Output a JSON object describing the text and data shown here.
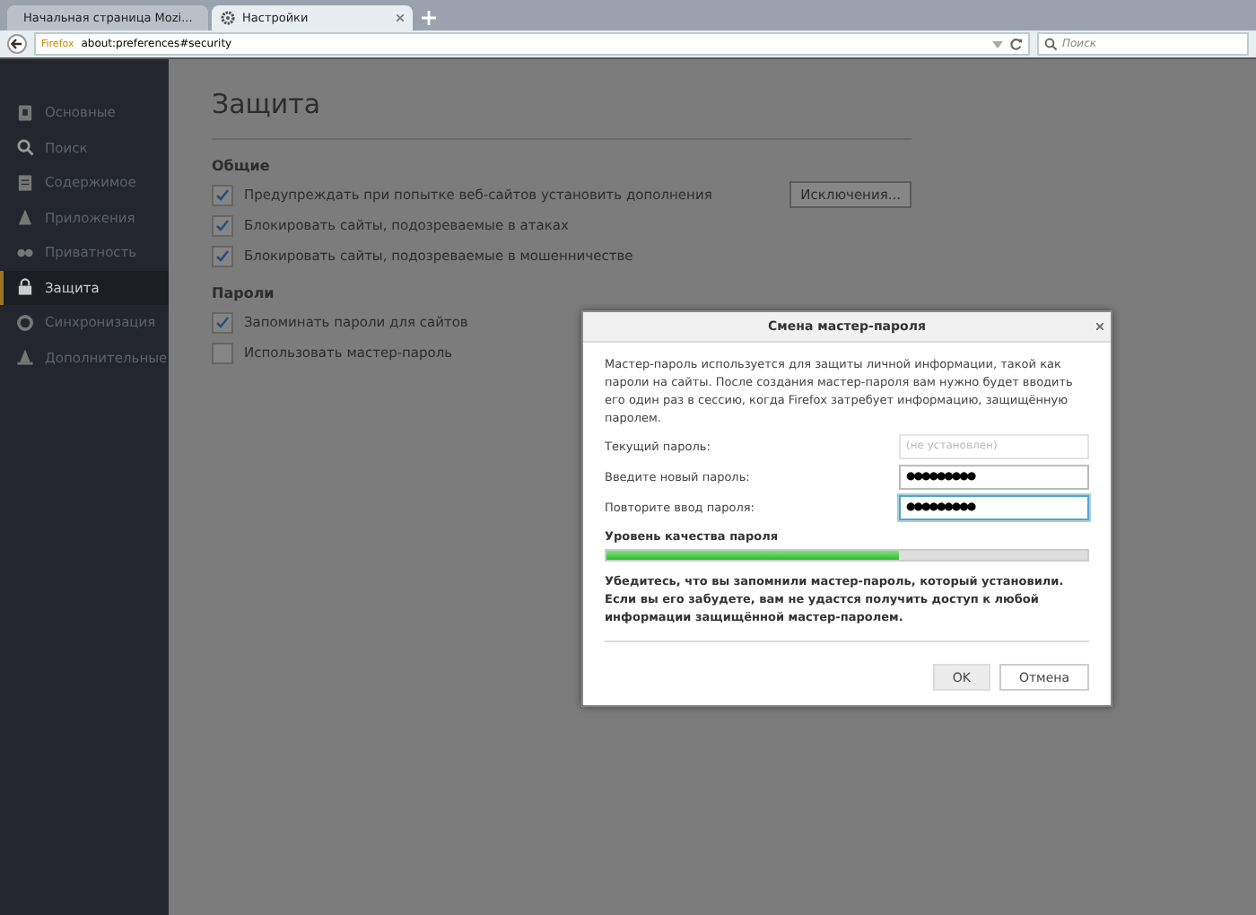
{
  "tabs": [
    {
      "label": "Начальная страница Mozi...",
      "selected": false,
      "kind": "firefox"
    },
    {
      "label": "Настройки",
      "selected": true,
      "kind": "settings"
    }
  ],
  "toolbar": {
    "identity": "Firefox",
    "url": "about:preferences#security",
    "search_placeholder": "Поиск"
  },
  "sidebar": {
    "items": [
      {
        "label": "Основные",
        "kind": "general",
        "selected": false
      },
      {
        "label": "Поиск",
        "kind": "search",
        "selected": false
      },
      {
        "label": "Содержимое",
        "kind": "content",
        "selected": false
      },
      {
        "label": "Приложения",
        "kind": "apps",
        "selected": false
      },
      {
        "label": "Приватность",
        "kind": "privacy",
        "selected": false
      },
      {
        "label": "Защита",
        "kind": "security",
        "selected": true
      },
      {
        "label": "Синхронизация",
        "kind": "sync",
        "selected": false
      },
      {
        "label": "Дополнительные",
        "kind": "advanced",
        "selected": false
      }
    ]
  },
  "page": {
    "title": "Защита",
    "sections": [
      {
        "heading": "Общие",
        "options": [
          {
            "label": "Предупреждать при попытке веб-сайтов установить дополнения",
            "checked": true,
            "button": "Исключения..."
          },
          {
            "label": "Блокировать сайты, подозреваемые в атаках",
            "checked": true
          },
          {
            "label": "Блокировать сайты, подозреваемые в мошенничестве",
            "checked": true
          }
        ]
      },
      {
        "heading": "Пароли",
        "options": [
          {
            "label": "Запоминать пароли для сайтов",
            "checked": true
          },
          {
            "label": "Использовать мастер-пароль",
            "checked": false
          }
        ]
      }
    ]
  },
  "dialog": {
    "title": "Смена мастер-пароля",
    "intro": "Мастер-пароль используется для защиты личной информации, такой как пароли на сайты. После создания мастер-пароля вам нужно будет вводить его один раз в сессию, когда Firefox затребует информацию, защищённую паролем.",
    "fields": [
      {
        "label": "Текущий пароль:",
        "placeholder": "(не установлен)",
        "disabled": true,
        "focused": false
      },
      {
        "label": "Введите новый пароль:",
        "value": "●●●●●●●●●",
        "disabled": false,
        "focused": false
      },
      {
        "label": "Повторите ввод пароля:",
        "value": "●●●●●●●●●",
        "disabled": false,
        "focused": true
      }
    ],
    "quality_label": "Уровень качества пароля",
    "quality": {
      "level": 0.61
    },
    "warning": "Убедитесь, что вы запомнили мастер-пароль, который установили. Если вы его забудете, вам не удастся получить доступ к любой информации защищённой мастер-паролем.",
    "buttons": [
      {
        "label": "OK",
        "kind": "default"
      },
      {
        "label": "Отмена",
        "kind": "normal"
      }
    ]
  }
}
